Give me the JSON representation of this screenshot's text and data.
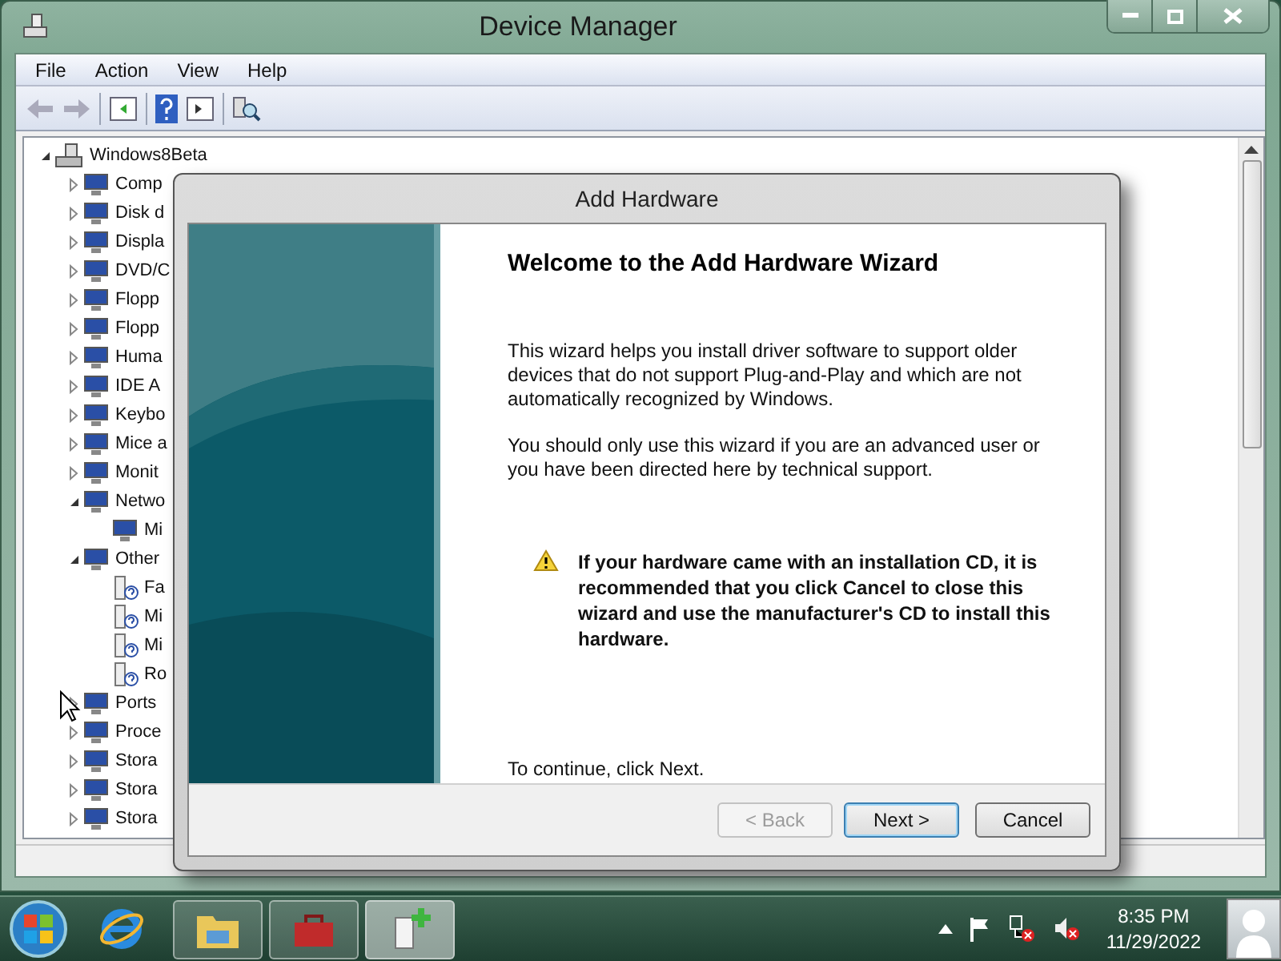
{
  "device_manager": {
    "title": "Device Manager",
    "menu": [
      "File",
      "Action",
      "View",
      "Help"
    ],
    "tree": {
      "label": "Windows8Beta",
      "expanded": true,
      "children": [
        {
          "label": "Comp",
          "expanded": false
        },
        {
          "label": "Disk d",
          "expanded": false
        },
        {
          "label": "Displa",
          "expanded": false
        },
        {
          "label": "DVD/C",
          "expanded": false
        },
        {
          "label": "Flopp",
          "expanded": false
        },
        {
          "label": "Flopp",
          "expanded": false
        },
        {
          "label": "Huma",
          "expanded": false
        },
        {
          "label": "IDE A",
          "expanded": false
        },
        {
          "label": "Keybo",
          "expanded": false
        },
        {
          "label": "Mice a",
          "expanded": false
        },
        {
          "label": "Monit",
          "expanded": false
        },
        {
          "label": "Netwo",
          "expanded": true,
          "children": [
            {
              "label": "Mi"
            }
          ]
        },
        {
          "label": "Other",
          "expanded": true,
          "children": [
            {
              "label": "Fa"
            },
            {
              "label": "Mi"
            },
            {
              "label": "Mi"
            },
            {
              "label": "Ro"
            }
          ]
        },
        {
          "label": "Ports",
          "expanded": false
        },
        {
          "label": "Proce",
          "expanded": false
        },
        {
          "label": "Stora",
          "expanded": false
        },
        {
          "label": "Stora",
          "expanded": false
        },
        {
          "label": "Stora",
          "expanded": false
        }
      ]
    }
  },
  "dialog": {
    "title": "Add Hardware",
    "heading": "Welcome to the Add Hardware Wizard",
    "paragraphs": [
      "This wizard helps you install driver software to support older devices that do not support Plug-and-Play and which are not automatically recognized by Windows.",
      "You should only use this wizard if you are an advanced user or you have been directed here by technical support."
    ],
    "warning": "If your hardware came with an installation CD, it is recommended that you click Cancel to close this wizard and use the manufacturer's CD to install this hardware.",
    "footer": "To continue, click Next.",
    "buttons": [
      {
        "label": "< Back",
        "disabled": true,
        "default": false
      },
      {
        "label": "Next >",
        "disabled": false,
        "default": true
      },
      {
        "label": "Cancel",
        "disabled": false,
        "default": false
      }
    ]
  },
  "taskbar": {
    "apps": [
      {
        "kind": "browser",
        "running": false,
        "selected": false
      },
      {
        "kind": "folder",
        "running": true,
        "selected": false
      },
      {
        "kind": "toolbox",
        "running": true,
        "selected": false
      },
      {
        "kind": "hardware",
        "running": true,
        "selected": true
      }
    ],
    "clock": {
      "time": "8:35 PM",
      "date": "11/29/2022"
    }
  }
}
